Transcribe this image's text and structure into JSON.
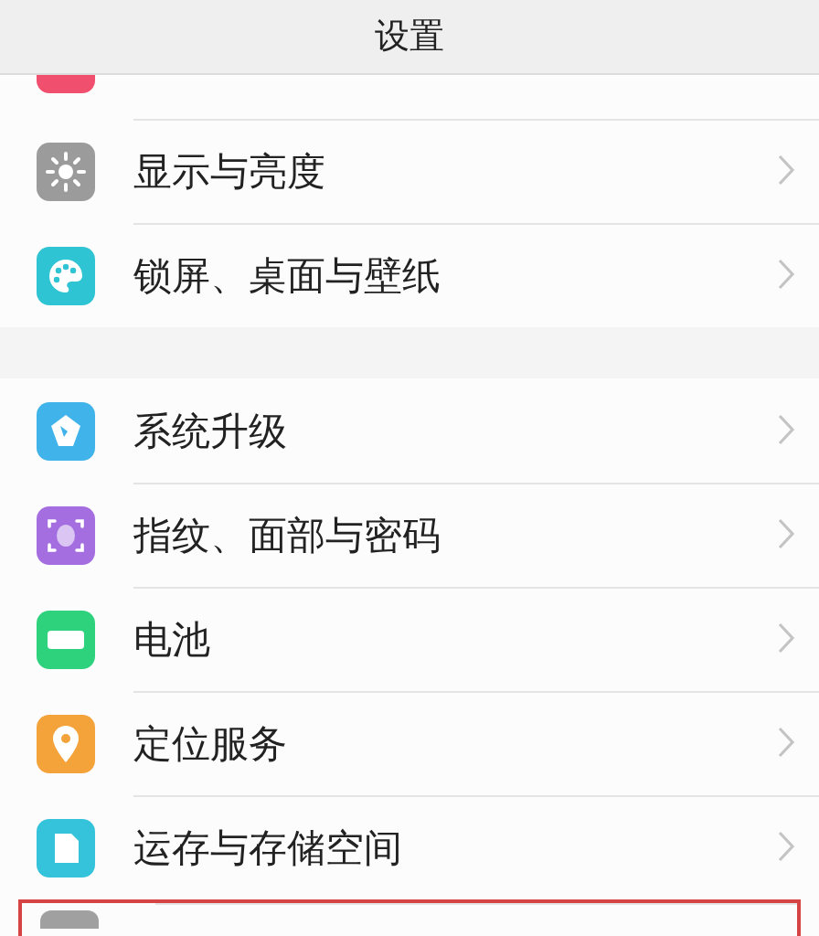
{
  "header": {
    "title": "设置"
  },
  "groups": [
    {
      "items": [
        {
          "kind": "partial_top",
          "color": "#f0506e",
          "highlighted": false
        },
        {
          "kind": "full",
          "label": "显示与亮度",
          "color": "#9b9b9b",
          "highlighted": false
        },
        {
          "kind": "full",
          "label": "锁屏、桌面与壁纸",
          "color": "#2fc4d4",
          "highlighted": false
        }
      ]
    },
    {
      "items": [
        {
          "kind": "full",
          "label": "系统升级",
          "color": "#3fb3ea",
          "highlighted": false
        },
        {
          "kind": "full",
          "label": "指纹、面部与密码",
          "color": "#a56ee0",
          "highlighted": false
        },
        {
          "kind": "full",
          "label": "电池",
          "color": "#2fd27c",
          "highlighted": false
        },
        {
          "kind": "full",
          "label": "定位服务",
          "color": "#f4a23a",
          "highlighted": false
        },
        {
          "kind": "full",
          "label": "运存与存储空间",
          "color": "#35c3dc",
          "highlighted": false
        },
        {
          "kind": "partial_bottom",
          "color": "#a0a0a0",
          "highlighted": true
        }
      ]
    }
  ]
}
